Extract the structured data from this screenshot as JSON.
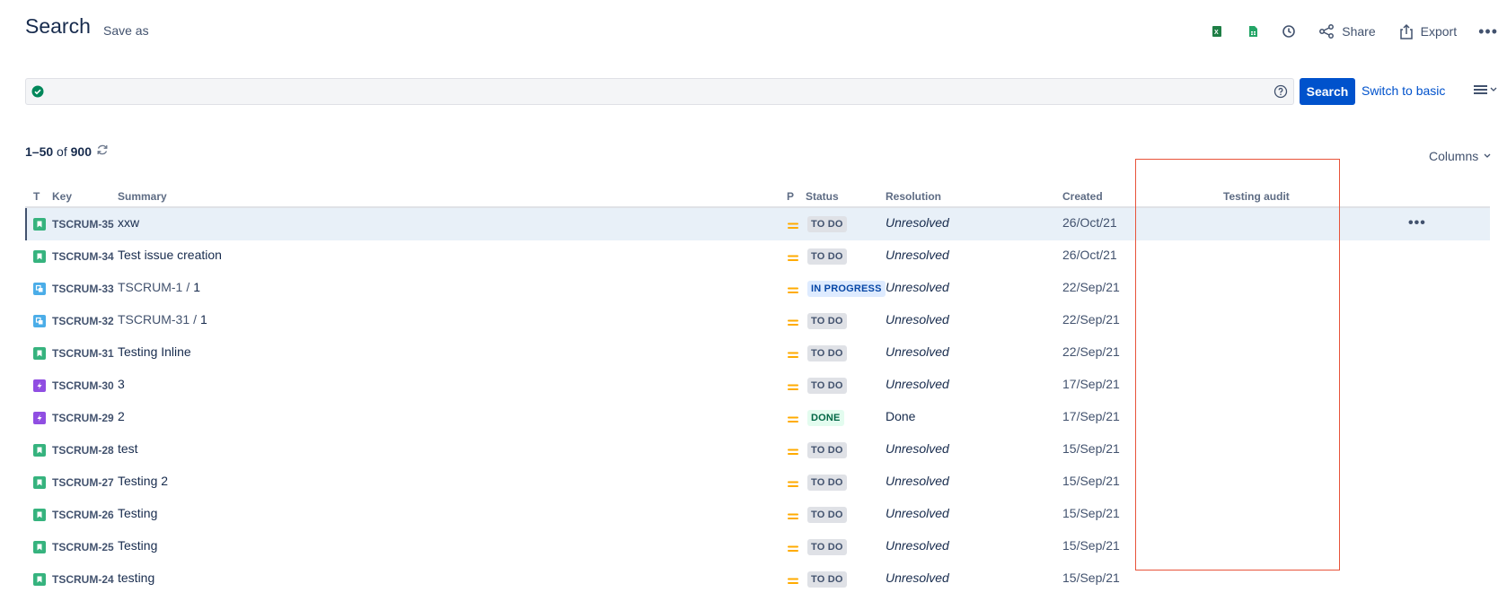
{
  "header": {
    "title": "Search",
    "save_as": "Save as",
    "toolbar": {
      "icons": [
        "excel-icon",
        "google-sheets-icon",
        "clock-icon"
      ],
      "share_label": "Share",
      "export_label": "Export",
      "more": "•••"
    }
  },
  "search": {
    "query": "",
    "search_button": "Search",
    "switch_label": "Switch to basic"
  },
  "results": {
    "range": "1–50",
    "of": "of",
    "total": "900",
    "columns_label": "Columns"
  },
  "table": {
    "headers": {
      "t": "T",
      "key": "Key",
      "summary": "Summary",
      "p": "P",
      "status": "Status",
      "resolution": "Resolution",
      "created": "Created",
      "testing_audit": "Testing audit"
    },
    "row_menu": "•••",
    "rows": [
      {
        "type": "story",
        "key": "TSCRUM-35",
        "summary": "xxw",
        "parent": "",
        "status": "TO DO",
        "resolution": "Unresolved",
        "created": "26/Oct/21"
      },
      {
        "type": "story",
        "key": "TSCRUM-34",
        "summary": "Test issue creation",
        "parent": "",
        "status": "TO DO",
        "resolution": "Unresolved",
        "created": "26/Oct/21"
      },
      {
        "type": "subtask",
        "key": "TSCRUM-33",
        "summary": "1",
        "parent": "TSCRUM-1",
        "status": "IN PROGRESS",
        "resolution": "Unresolved",
        "created": "22/Sep/21"
      },
      {
        "type": "subtask",
        "key": "TSCRUM-32",
        "summary": "1",
        "parent": "TSCRUM-31",
        "status": "TO DO",
        "resolution": "Unresolved",
        "created": "22/Sep/21"
      },
      {
        "type": "story",
        "key": "TSCRUM-31",
        "summary": "Testing Inline",
        "parent": "",
        "status": "TO DO",
        "resolution": "Unresolved",
        "created": "22/Sep/21"
      },
      {
        "type": "epic",
        "key": "TSCRUM-30",
        "summary": "3",
        "parent": "",
        "status": "TO DO",
        "resolution": "Unresolved",
        "created": "17/Sep/21"
      },
      {
        "type": "epic",
        "key": "TSCRUM-29",
        "summary": "2",
        "parent": "",
        "status": "DONE",
        "resolution": "Done",
        "created": "17/Sep/21"
      },
      {
        "type": "story",
        "key": "TSCRUM-28",
        "summary": "test",
        "parent": "",
        "status": "TO DO",
        "resolution": "Unresolved",
        "created": "15/Sep/21"
      },
      {
        "type": "story",
        "key": "TSCRUM-27",
        "summary": "Testing 2",
        "parent": "",
        "status": "TO DO",
        "resolution": "Unresolved",
        "created": "15/Sep/21"
      },
      {
        "type": "story",
        "key": "TSCRUM-26",
        "summary": "Testing",
        "parent": "",
        "status": "TO DO",
        "resolution": "Unresolved",
        "created": "15/Sep/21"
      },
      {
        "type": "story",
        "key": "TSCRUM-25",
        "summary": "Testing",
        "parent": "",
        "status": "TO DO",
        "resolution": "Unresolved",
        "created": "15/Sep/21"
      },
      {
        "type": "story",
        "key": "TSCRUM-24",
        "summary": "testing",
        "parent": "",
        "status": "TO DO",
        "resolution": "Unresolved",
        "created": "15/Sep/21"
      }
    ]
  },
  "colors": {
    "primary": "#0052cc",
    "story": "#36b37e",
    "subtask": "#4bade8",
    "epic": "#904ee2",
    "priority_medium": "#ffab00",
    "highlight": "#e8533a"
  }
}
